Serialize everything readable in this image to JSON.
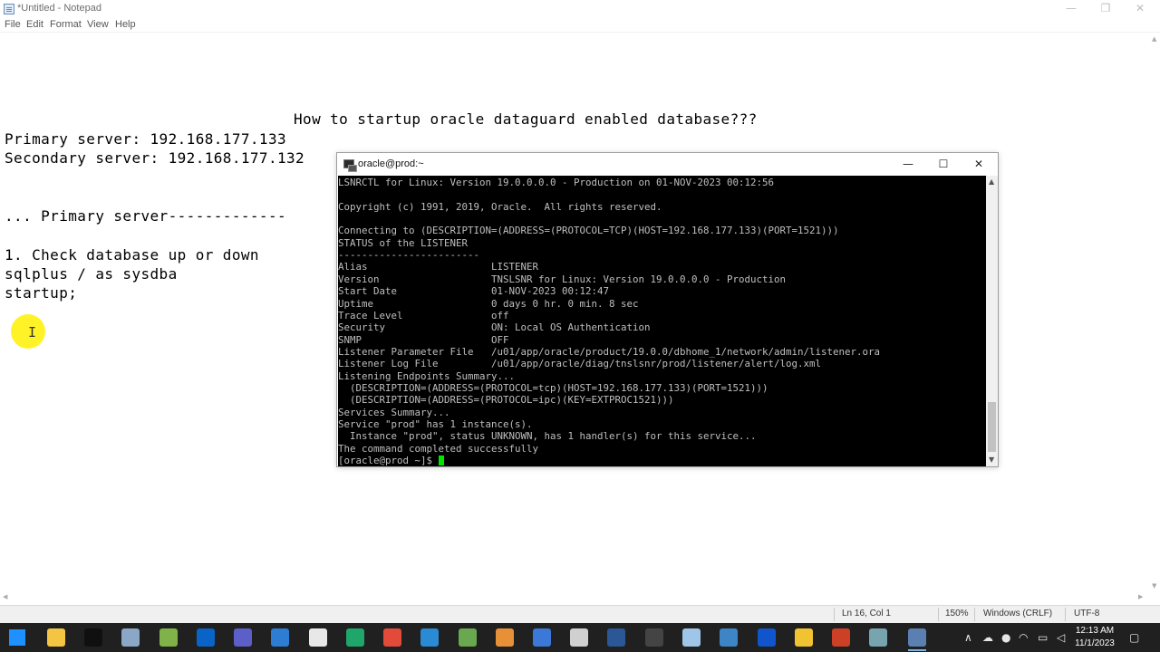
{
  "notepad": {
    "title": "*Untitled - Notepad",
    "menu": [
      "File",
      "Edit",
      "Format",
      "View",
      "Help"
    ],
    "window_buttons": {
      "minimize": "—",
      "restore": "❐",
      "close": "✕"
    },
    "lines": {
      "heading": "How to startup oracle dataguard enabled database???",
      "primary": "Primary server: 192.168.177.133",
      "secondary": "Secondary server: 192.168.177.132",
      "primary_section": "... Primary server-------------",
      "step1": "1. Check database up or down",
      "sqlplus": "sqlplus / as sysdba",
      "startup": "startup;"
    },
    "ibeam": "I",
    "status": {
      "position": "Ln 16, Col 1",
      "zoom": "150%",
      "line_ending": "Windows (CRLF)",
      "encoding": "UTF-8"
    }
  },
  "putty": {
    "title": "oracle@prod:~",
    "window_buttons": {
      "minimize": "—",
      "maximize": "☐",
      "close": "✕"
    },
    "lines": [
      "LSNRCTL for Linux: Version 19.0.0.0.0 - Production on 01-NOV-2023 00:12:56",
      "",
      "Copyright (c) 1991, 2019, Oracle.  All rights reserved.",
      "",
      "Connecting to (DESCRIPTION=(ADDRESS=(PROTOCOL=TCP)(HOST=192.168.177.133)(PORT=1521)))",
      "STATUS of the LISTENER",
      "------------------------",
      "Alias                     LISTENER",
      "Version                   TNSLSNR for Linux: Version 19.0.0.0.0 - Production",
      "Start Date                01-NOV-2023 00:12:47",
      "Uptime                    0 days 0 hr. 0 min. 8 sec",
      "Trace Level               off",
      "Security                  ON: Local OS Authentication",
      "SNMP                      OFF",
      "Listener Parameter File   /u01/app/oracle/product/19.0.0/dbhome_1/network/admin/listener.ora",
      "Listener Log File         /u01/app/oracle/diag/tnslsnr/prod/listener/alert/log.xml",
      "Listening Endpoints Summary...",
      "  (DESCRIPTION=(ADDRESS=(PROTOCOL=tcp)(HOST=192.168.177.133)(PORT=1521)))",
      "  (DESCRIPTION=(ADDRESS=(PROTOCOL=ipc)(KEY=EXTPROC1521)))",
      "Services Summary...",
      "Service \"prod\" has 1 instance(s).",
      "  Instance \"prod\", status UNKNOWN, has 1 handler(s) for this service...",
      "The command completed successfully"
    ],
    "prompt": "[oracle@prod ~]$ "
  },
  "taskbar": {
    "icons": [
      {
        "name": "windows-start-icon",
        "color": "#1e90ff"
      },
      {
        "name": "file-explorer-icon",
        "color": "#f4c542"
      },
      {
        "name": "terminal-icon",
        "color": "#101010"
      },
      {
        "name": "app-icon-1",
        "color": "#8aa7c7"
      },
      {
        "name": "app-icon-2",
        "color": "#7fb34a"
      },
      {
        "name": "outlook-icon",
        "color": "#0a64c8"
      },
      {
        "name": "teams-icon",
        "color": "#5b5fc7"
      },
      {
        "name": "app-icon-3",
        "color": "#2d7dd2"
      },
      {
        "name": "app-icon-4",
        "color": "#e8e8e8"
      },
      {
        "name": "edge-icon",
        "color": "#1fa66a"
      },
      {
        "name": "chrome-icon",
        "color": "#e24a3a"
      },
      {
        "name": "vscode-icon",
        "color": "#2a8ad4"
      },
      {
        "name": "app-icon-5",
        "color": "#6aa84f"
      },
      {
        "name": "app-icon-6",
        "color": "#e69138"
      },
      {
        "name": "app-icon-7",
        "color": "#3c78d8"
      },
      {
        "name": "app-icon-8",
        "color": "#d0d0d0"
      },
      {
        "name": "app-icon-9",
        "color": "#2b5797"
      },
      {
        "name": "app-icon-10",
        "color": "#444444"
      },
      {
        "name": "virtualbox-icon",
        "color": "#9fc5e8"
      },
      {
        "name": "app-icon-11",
        "color": "#3d85c6"
      },
      {
        "name": "app-icon-12",
        "color": "#1155cc"
      },
      {
        "name": "app-icon-13",
        "color": "#f1c232"
      },
      {
        "name": "app-icon-14",
        "color": "#cc4125"
      },
      {
        "name": "app-icon-15",
        "color": "#76a5af"
      },
      {
        "name": "putty-icon",
        "color": "#5a7fb0"
      }
    ],
    "tray": {
      "chevron": "∧",
      "time": "12:13 AM",
      "date": "11/1/2023"
    }
  }
}
